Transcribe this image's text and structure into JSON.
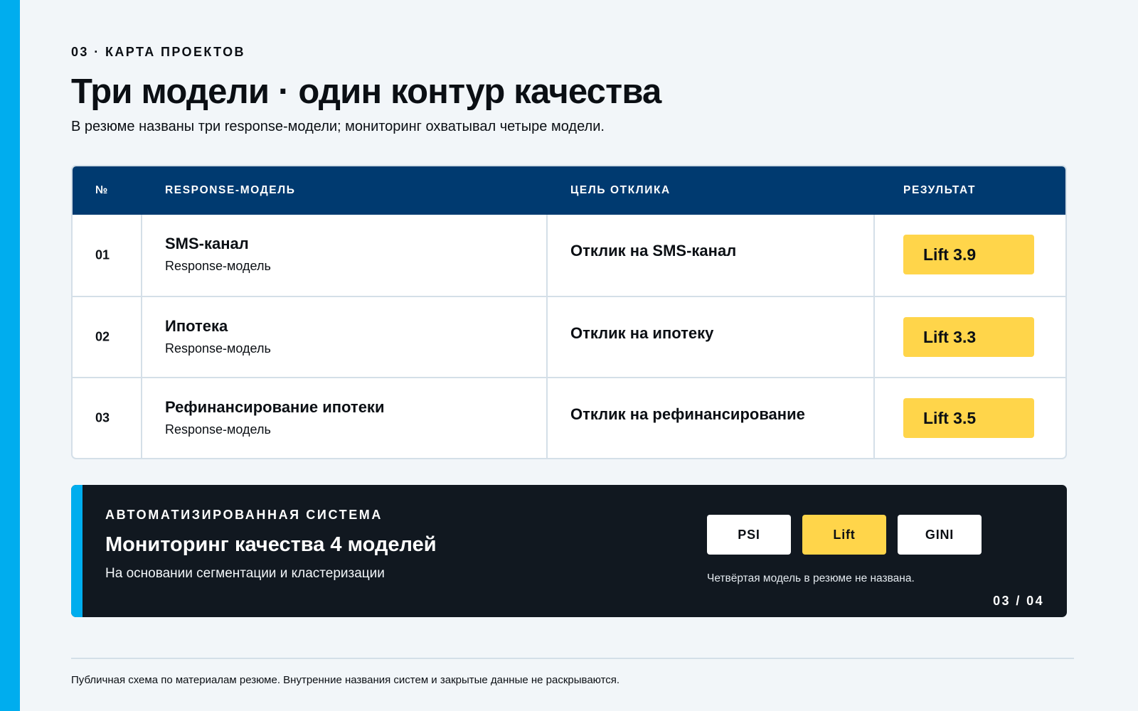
{
  "header": {
    "eyebrow": "03 · КАРТА ПРОЕКТОВ",
    "title": "Три модели · один контур качества",
    "subtitle": "В резюме названы три response-модели; мониторинг охватывал четыре модели."
  },
  "table": {
    "columns": [
      "№",
      "RESPONSE-МОДЕЛЬ",
      "ЦЕЛЬ ОТКЛИКА",
      "РЕЗУЛЬТАТ"
    ],
    "rows": [
      {
        "num": "01",
        "name": "SMS-канал",
        "type": "Response-модель",
        "goal": "Отклик на SMS-канал",
        "result": "Lift 3.9"
      },
      {
        "num": "02",
        "name": "Ипотека",
        "type": "Response-модель",
        "goal": "Отклик на ипотеку",
        "result": "Lift 3.3"
      },
      {
        "num": "03",
        "name": "Рефинансирование ипотеки",
        "type": "Response-модель",
        "goal": "Отклик на рефинансирование",
        "result": "Lift 3.5"
      }
    ]
  },
  "panel": {
    "eyebrow": "АВТОМАТИЗИРОВАННАЯ СИСТЕМА",
    "title": "Мониторинг качества 4 моделей",
    "description": "На основании сегментации и кластеризации",
    "metrics": [
      {
        "label": "PSI",
        "active": false
      },
      {
        "label": "Lift",
        "active": true
      },
      {
        "label": "GINI",
        "active": false
      }
    ],
    "note": "Четвёртая модель в резюме не названа.",
    "pager": "03 / 04"
  },
  "footer": {
    "note": "Публичная схема по материалам резюме. Внутренние названия систем и закрытые данные не раскрываются."
  },
  "colors": {
    "accent": "#00adee",
    "header_bg": "#003a70",
    "highlight": "#ffd54a",
    "panel_bg": "#111820"
  }
}
